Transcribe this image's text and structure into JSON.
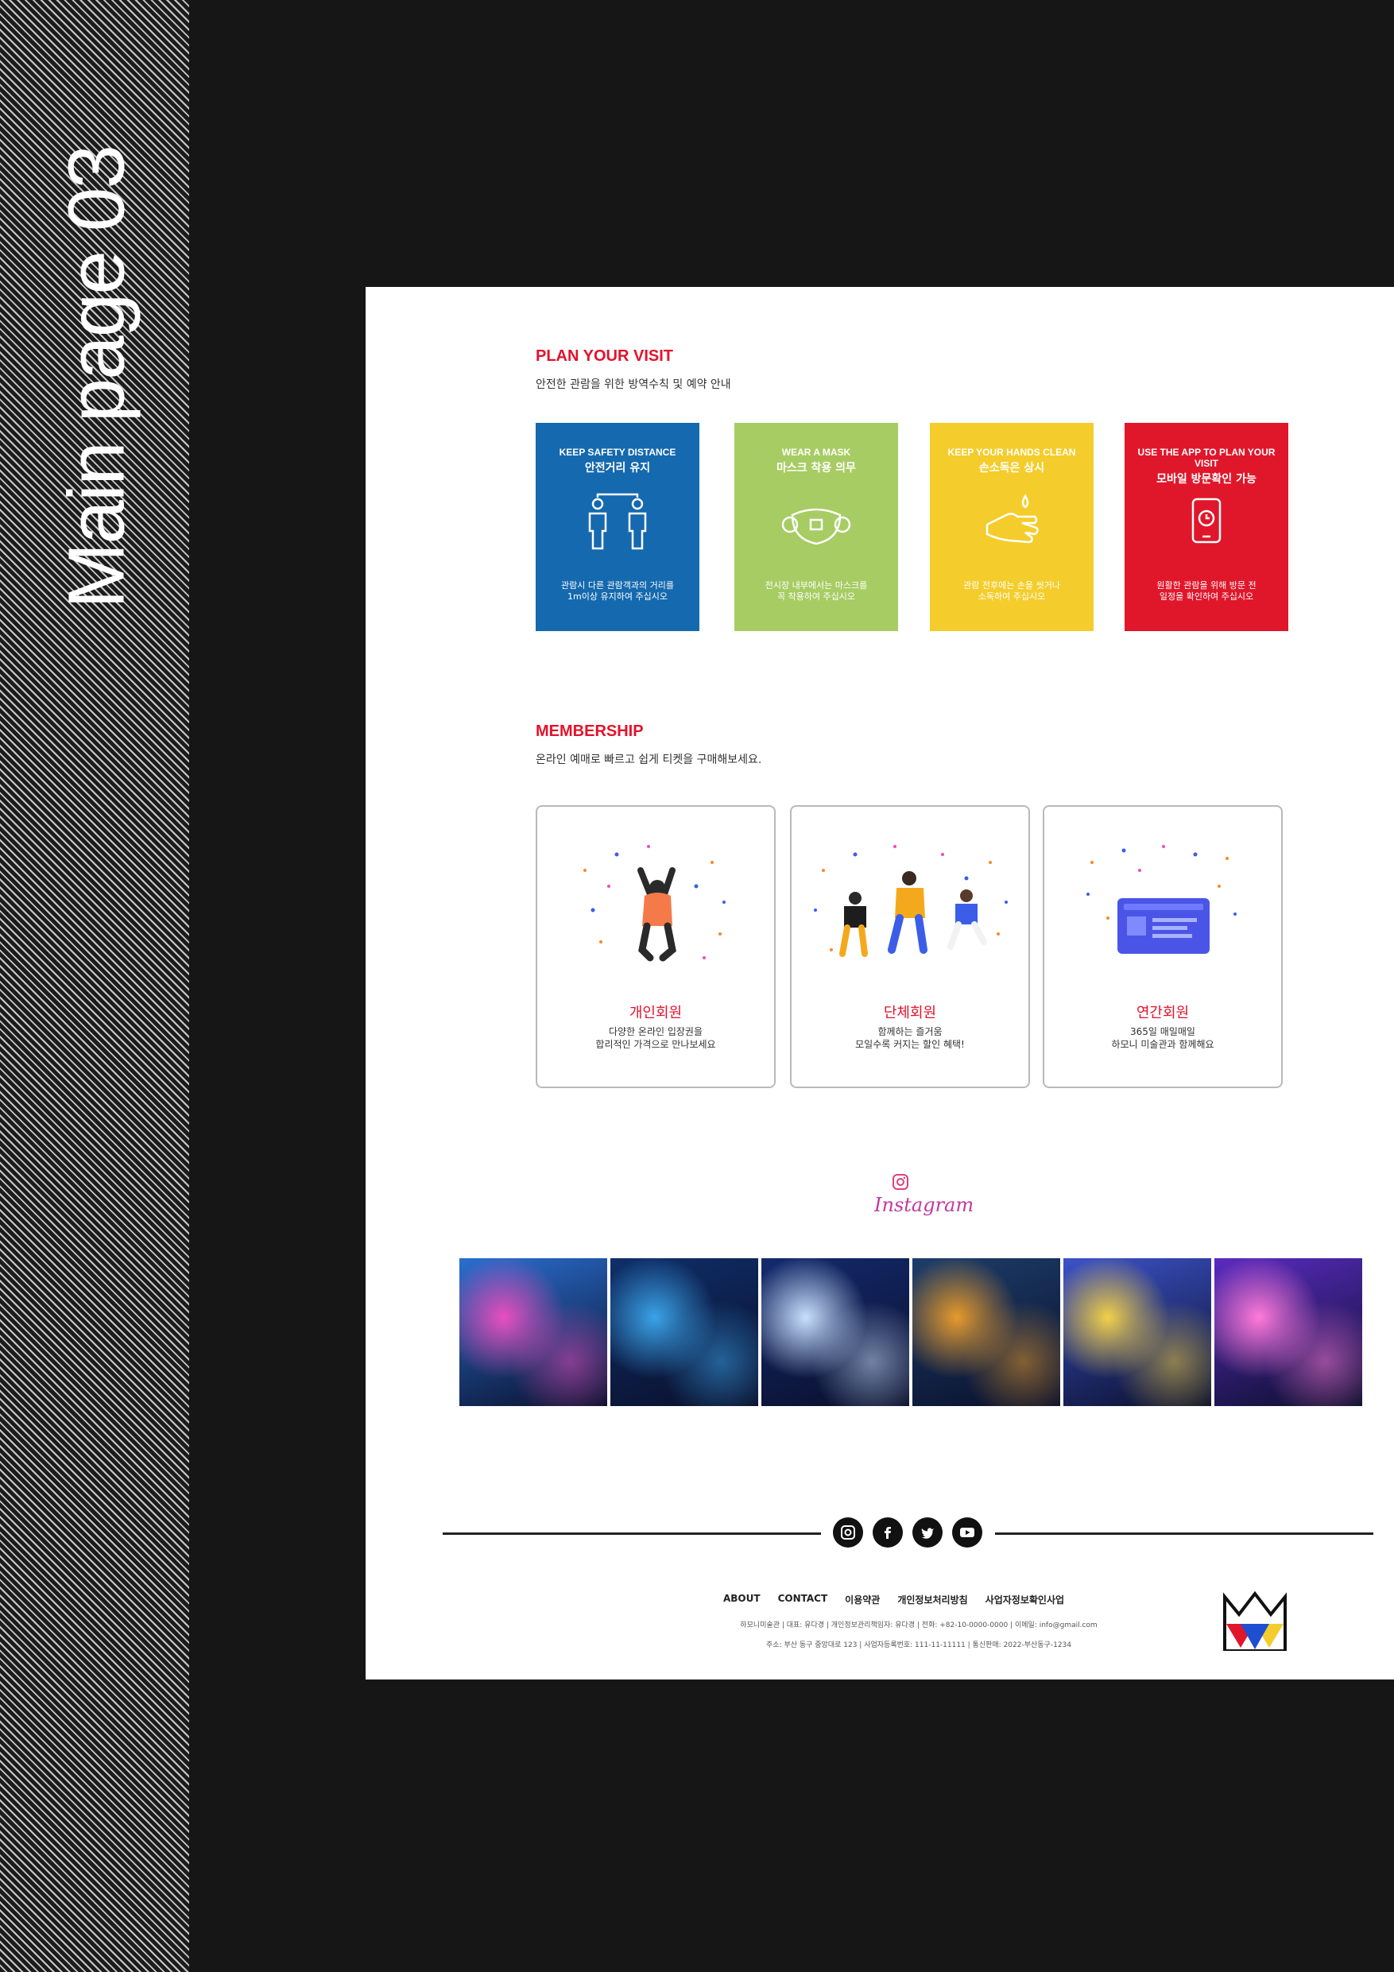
{
  "side_label": "Main page 03",
  "plan": {
    "title": "PLAN YOUR VISIT",
    "subtitle": "안전한 관람을 위한 방역수칙 및 예약 안내",
    "cards": [
      {
        "en": "KEEP SAFETY DISTANCE",
        "ko": "안전거리 유지",
        "desc1": "관람시 다른 관람객과의 거리를",
        "desc2": "1m이상 유지하여 주십시오",
        "color": "#1569ae",
        "icon": "people-distance-icon"
      },
      {
        "en": "WEAR A MASK",
        "ko": "마스크 착용 의무",
        "desc1": "전시장 내부에서는 마스크를",
        "desc2": "꼭 착용하여 주십시오",
        "color": "#a7cc63",
        "icon": "mask-icon"
      },
      {
        "en": "KEEP YOUR HANDS CLEAN",
        "ko": "손소독은 상시",
        "desc1": "관람 전후에는 손을 씻거나",
        "desc2": "소독하여 주십시오",
        "color": "#f4cd2c",
        "icon": "hand-sanitize-icon"
      },
      {
        "en": "USE THE APP TO PLAN YOUR VISIT",
        "ko": "모바일 방문확인 가능",
        "desc1": "원활한 관람을 위해 방문 전",
        "desc2": "일정을 확인하여 주십시오",
        "color": "#e0172b",
        "icon": "phone-clock-icon"
      }
    ]
  },
  "membership": {
    "title": "MEMBERSHIP",
    "subtitle": "온라인 예매로 빠르고 쉽게 티켓을 구매해보세요.",
    "cards": [
      {
        "title": "개인회원",
        "desc1": "다양한 온라인 입장권을",
        "desc2": "합리적인 가격으로 만나보세요"
      },
      {
        "title": "단체회원",
        "desc1": "함께하는 즐거움",
        "desc2": "모일수록 커지는 할인 혜택!"
      },
      {
        "title": "연간회원",
        "desc1": "365일 매일매일",
        "desc2": "하모니 미술관과 함께해요"
      }
    ]
  },
  "instagram": {
    "label": "Instagram"
  },
  "gallery": [
    {
      "bg": "#2a6fd0",
      "accent": "#e84fc0"
    },
    {
      "bg": "#0f2f6a",
      "accent": "#3aa3e8"
    },
    {
      "bg": "#142a6e",
      "accent": "#c8e0ff"
    },
    {
      "bg": "#1d3e6a",
      "accent": "#e69a2c"
    },
    {
      "bg": "#3c52c8",
      "accent": "#f2d04a"
    },
    {
      "bg": "#5a2bc0",
      "accent": "#ff7ad9"
    }
  ],
  "social": [
    "instagram-icon",
    "facebook-icon",
    "twitter-icon",
    "youtube-icon"
  ],
  "footer": {
    "nav": [
      "ABOUT",
      "CONTACT",
      "이용약관",
      "개인정보처리방침",
      "사업자정보확인사업"
    ],
    "info1": "하모니미술관 | 대표: 유다경 | 개인정보관리책임자: 유다경 | 전화: +82-10-0000-0000 | 이메일: info@gmail.com",
    "info2": "주소: 부산 동구 중앙대로 123 | 사업자등록번호: 111-11-11111 | 통신판매: 2022-부산동구-1234"
  }
}
